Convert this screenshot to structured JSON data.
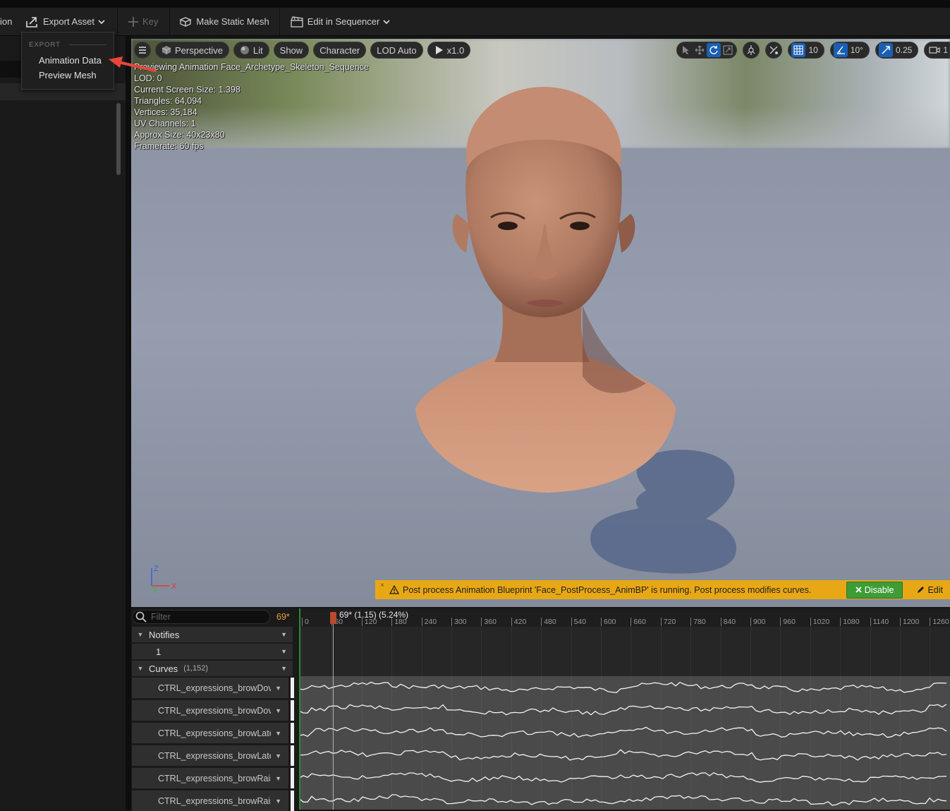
{
  "toolbar": {
    "partial_label": "ion",
    "export_asset": "Export Asset",
    "key": "Key",
    "make_static_mesh": "Make Static Mesh",
    "edit_in_sequencer": "Edit in Sequencer"
  },
  "export_menu": {
    "section": "EXPORT",
    "items": [
      "Animation Data",
      "Preview Mesh"
    ]
  },
  "viewport": {
    "perspective": "Perspective",
    "lit": "Lit",
    "show": "Show",
    "character": "Character",
    "lod": "LOD Auto",
    "play_speed": "x1.0",
    "grid_snap": "10",
    "rot_snap": "10°",
    "scale_snap": "0.25",
    "camera_speed": "1",
    "stats": [
      "Previewing Animation Face_Archetype_Skeleton_Sequence",
      "LOD: 0",
      "Current Screen Size: 1.398",
      "Triangles: 64,094",
      "Vertices: 35,184",
      "UV Channels: 1",
      "Approx Size: 40x23x80",
      "Framerate: 60 fps"
    ],
    "axis_labels": {
      "z": "Z",
      "x": "X",
      "y": "Y"
    }
  },
  "warning": {
    "close": "×",
    "text": "Post process Animation Blueprint 'Face_PostProcess_AnimBP' is running. Post process modifies curves.",
    "disable": "Disable",
    "edit": "Edit"
  },
  "tracks": {
    "filter_placeholder": "Filter",
    "frame": "69*",
    "notifies": "Notifies",
    "notify_track": "1",
    "curves": "Curves",
    "curves_count": "(1,152)",
    "curve_items": [
      "CTRL_expressions_browDov",
      "CTRL_expressions_browDov",
      "CTRL_expressions_browLate",
      "CTRL_expressions_browLate",
      "CTRL_expressions_browRais",
      "CTRL_expressions_browRais"
    ]
  },
  "timeline": {
    "playhead_label": "69* (1.15) (5.24%)",
    "ticks": [
      "0",
      "60",
      "120",
      "180",
      "240",
      "300",
      "360",
      "420",
      "480",
      "540",
      "600",
      "660",
      "720",
      "780",
      "840",
      "900",
      "960",
      "1020",
      "1080",
      "1140",
      "1200",
      "1260"
    ]
  },
  "colors": {
    "accent_blue": "#1a5fb4",
    "warning_yellow": "#e8a816",
    "disable_green": "#3f9c35",
    "frame_orange": "#e6a23c",
    "playhead_red": "#b74a2e"
  }
}
